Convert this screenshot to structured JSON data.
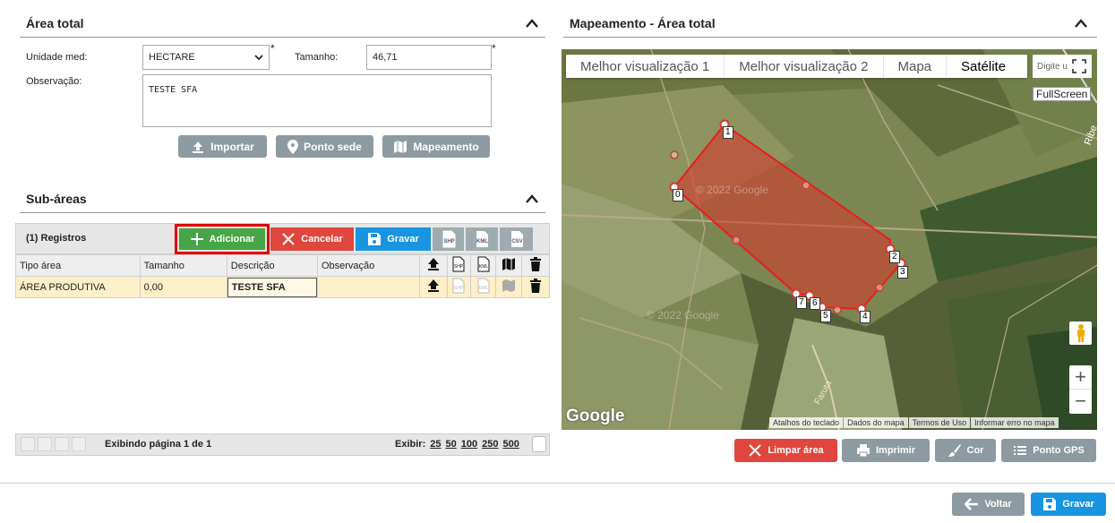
{
  "area_total": {
    "title": "Área total",
    "unidade_label": "Unidade med:",
    "unidade_value": "HECTARE",
    "tamanho_label": "Tamanho:",
    "tamanho_value": "46,71",
    "observacao_label": "Observação:",
    "observacao_value": "TESTE SFA",
    "required_mark": "*",
    "buttons": {
      "importar": "Importar",
      "ponto_sede": "Ponto sede",
      "mapeamento": "Mapeamento"
    }
  },
  "sub_areas": {
    "title": "Sub-áreas",
    "records_label": "(1) Registros",
    "toolbar": {
      "adicionar": "Adicionar",
      "cancelar": "Cancelar",
      "gravar": "Gravar",
      "shp": "SHP",
      "kml": "KML",
      "csv": "CSV"
    },
    "columns": [
      "Tipo área",
      "Tamanho",
      "Descrição",
      "Observação"
    ],
    "rows": [
      {
        "tipo": "ÁREA PRODUTIVA",
        "tamanho": "0,00",
        "descricao": "TESTE SFA",
        "observacao": ""
      }
    ],
    "pager": {
      "status": "Exibindo página 1 de 1",
      "exibir_label": "Exibir:",
      "sizes": [
        "25",
        "50",
        "100",
        "250",
        "500"
      ]
    }
  },
  "mapeamento": {
    "title": "Mapeamento - Área total",
    "tabs": [
      "Melhor visualização 1",
      "Melhor visualização 2",
      "Mapa",
      "Satélite"
    ],
    "active_tab": "Satélite",
    "search_placeholder": "Digite u",
    "fullscreen_tooltip": "FullScreen",
    "google_logo": "Google",
    "watermark": "© 2022 Google",
    "road_labels": [
      "Ribe",
      "Faruta"
    ],
    "vertex_labels": [
      "1",
      "0",
      "2",
      "3",
      "4",
      "5",
      "6",
      "7"
    ],
    "zoom_in": "+",
    "zoom_out": "−",
    "footer": [
      "Atalhos do teclado",
      "Dados do mapa",
      "Termos de Uso",
      "Informar erro no mapa"
    ],
    "buttons": {
      "limpar": "Limpar área",
      "imprimir": "Imprimir",
      "cor": "Cor",
      "ponto_gps": "Ponto GPS"
    },
    "polygon_color": "#d33b2f"
  },
  "footer_buttons": {
    "voltar": "Voltar",
    "gravar": "Gravar"
  },
  "colors": {
    "green": "#46a546",
    "red": "#e0463d",
    "blue": "#1894e0",
    "gray": "#8d9aa1",
    "highlight": "#e00000"
  }
}
